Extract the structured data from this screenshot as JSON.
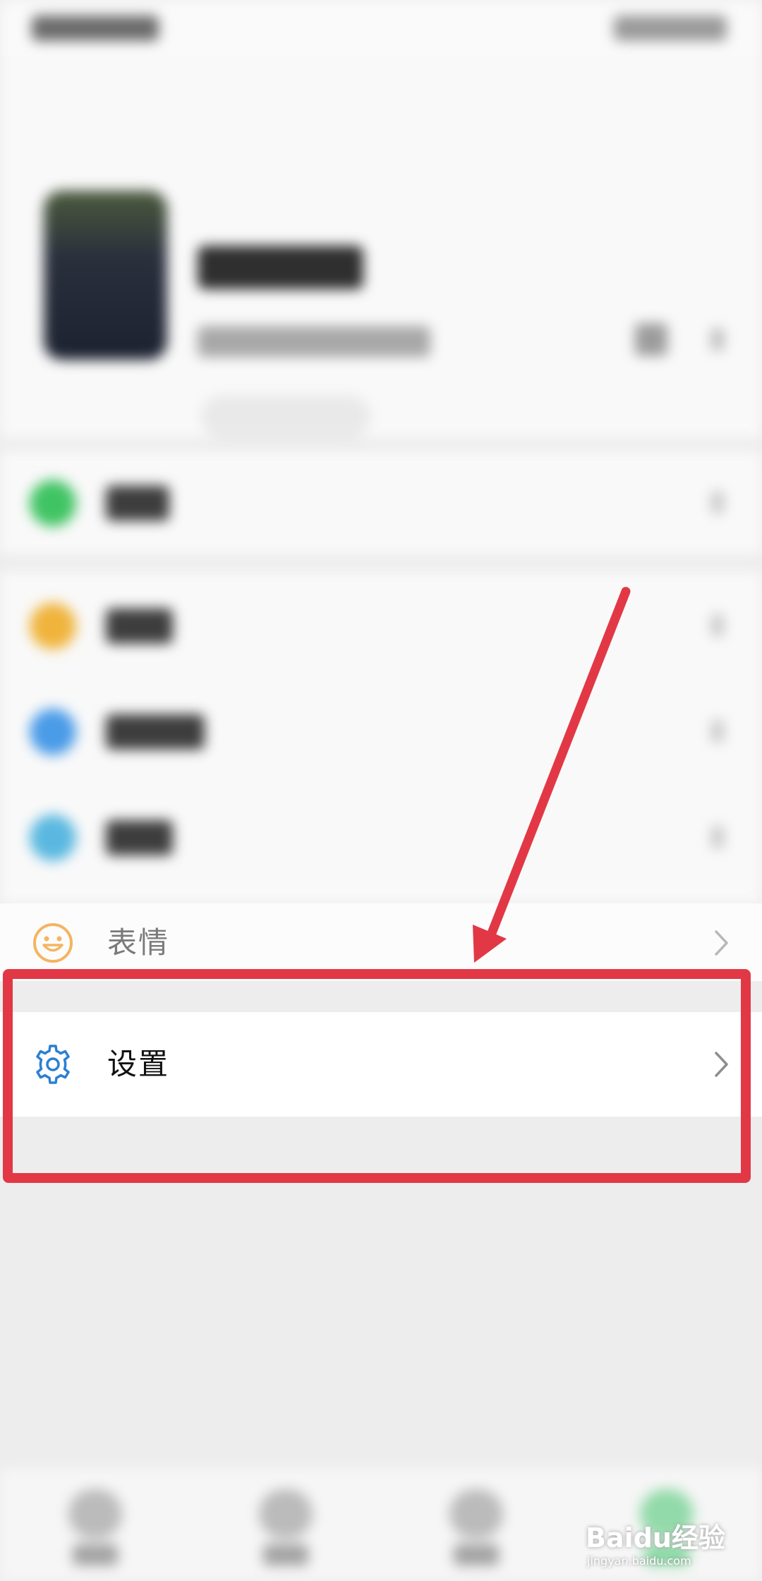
{
  "menu": {
    "expression": {
      "label": "表情",
      "icon": "smiley-icon",
      "icon_color": "#f5b461"
    },
    "settings": {
      "label": "设置",
      "icon": "gear-icon",
      "icon_color": "#2b7fd4"
    }
  },
  "annotation": {
    "highlight_color": "#e23846"
  },
  "watermark": {
    "brand": "Baidu经验",
    "url": "jingyan.baidu.com"
  }
}
